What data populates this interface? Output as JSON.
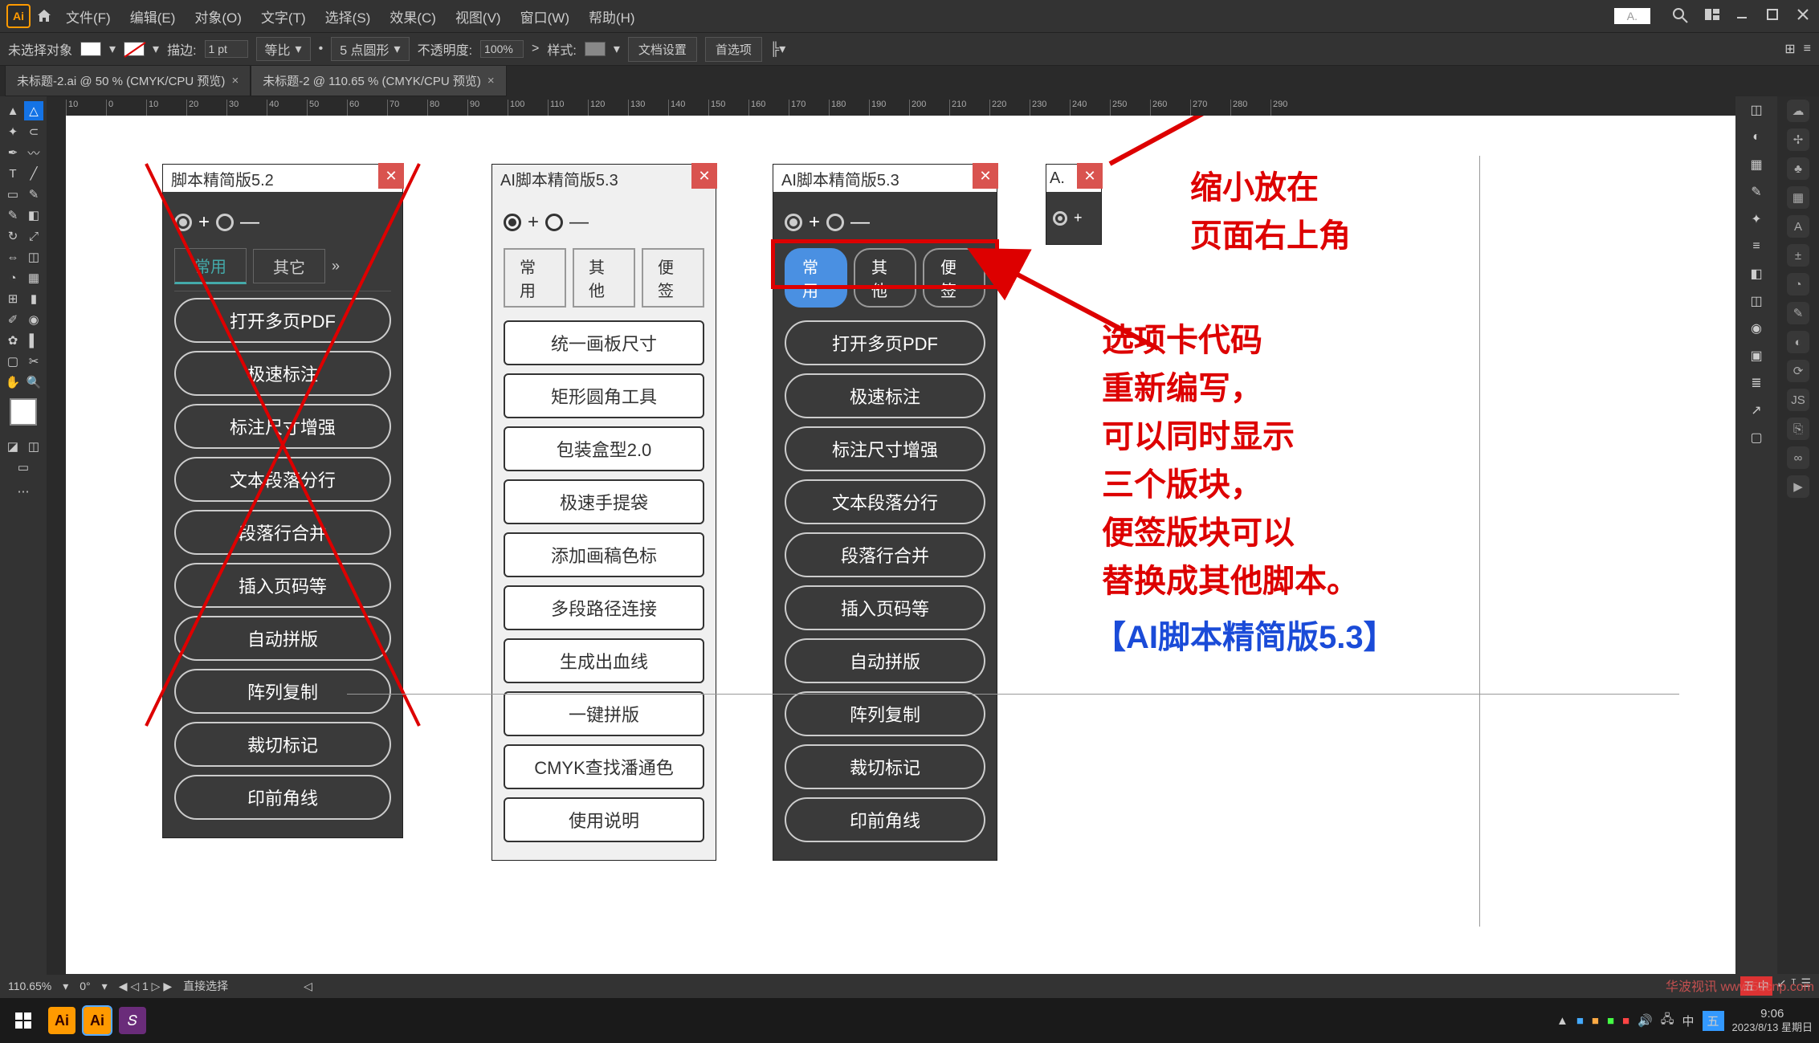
{
  "menubar": {
    "items": [
      "文件(F)",
      "编辑(E)",
      "对象(O)",
      "文字(T)",
      "选择(S)",
      "效果(C)",
      "视图(V)",
      "窗口(W)",
      "帮助(H)"
    ],
    "mini_label": "A."
  },
  "optbar": {
    "left_label": "未选择对象",
    "stroke_label": "描边:",
    "stroke_value": "1 pt",
    "uniform": "等比",
    "brush": "5 点圆形",
    "opacity_label": "不透明度:",
    "opacity_value": "100%",
    "style_label": "样式:",
    "doc_setup": "文档设置",
    "prefs": "首选项"
  },
  "tabs": [
    {
      "label": "未标题-2.ai @ 50 % (CMYK/CPU 预览)"
    },
    {
      "label": "未标题-2 @ 110.65 % (CMYK/CPU 预览)"
    }
  ],
  "ruler_h": [
    "10",
    "0",
    "10",
    "20",
    "30",
    "40",
    "50",
    "60",
    "70",
    "80",
    "90",
    "100",
    "110",
    "120",
    "130",
    "140",
    "150",
    "160",
    "170",
    "180",
    "190",
    "200",
    "210",
    "220",
    "230",
    "240",
    "250",
    "260",
    "270",
    "280",
    "290"
  ],
  "panel52": {
    "title": "脚本精简版5.2",
    "tabs": [
      "常用",
      "其它"
    ],
    "buttons": [
      "打开多页PDF",
      "极速标注",
      "标注尺寸增强",
      "文本段落分行",
      "段落行合并",
      "插入页码等",
      "自动拼版",
      "阵列复制",
      "裁切标记",
      "印前角线"
    ]
  },
  "panel53light": {
    "title": "AI脚本精简版5.3",
    "tabs": [
      "常用",
      "其他",
      "便签"
    ],
    "buttons": [
      "统一画板尺寸",
      "矩形圆角工具",
      "包装盒型2.0",
      "极速手提袋",
      "添加画稿色标",
      "多段路径连接",
      "生成出血线",
      "一键拼版",
      "CMYK查找潘通色",
      "使用说明"
    ]
  },
  "panel53dark": {
    "title": "AI脚本精简版5.3",
    "tabs": [
      "常用",
      "其他",
      "便签"
    ],
    "buttons": [
      "打开多页PDF",
      "极速标注",
      "标注尺寸增强",
      "文本段落分行",
      "段落行合并",
      "插入页码等",
      "自动拼版",
      "阵列复制",
      "裁切标记",
      "印前角线"
    ]
  },
  "panel_mini": {
    "title": "A."
  },
  "annotations": {
    "top": "缩小放在\n页面右上角",
    "mid": "选项卡代码\n重新编写，\n可以同时显示\n三个版块，\n便签版块可以\n替换成其他脚本。",
    "bottom": "【AI脚本精简版5.3】"
  },
  "statusbar": {
    "zoom": "110.65%",
    "rot": "0°",
    "nav": "1",
    "tool": "直接选择"
  },
  "taskbar": {
    "time": "9:06",
    "date": "2023/8/13 星期日",
    "ime": "五 中"
  },
  "watermark": "华波视讯 www.52cnp.com"
}
